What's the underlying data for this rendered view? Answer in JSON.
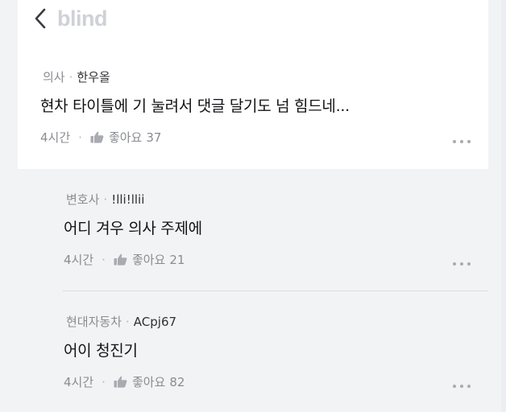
{
  "header": {
    "logo": "blind"
  },
  "post": {
    "company": "의사",
    "nickname": "한우올",
    "text": "현차 타이틀에 기 눌려서 댓글 달기도 넘 힘드네...",
    "time": "4시간",
    "like_label": "좋아요",
    "like_count": "37"
  },
  "comments": [
    {
      "company": "변호사",
      "nickname": "!lli!llii",
      "text": "어디 겨우 의사 주제에",
      "time": "4시간",
      "like_label": "좋아요",
      "like_count": "21"
    },
    {
      "company": "현대자동차",
      "nickname": "ACpj67",
      "text": "어이 청진기",
      "time": "4시간",
      "like_label": "좋아요",
      "like_count": "82"
    }
  ],
  "icons": {
    "back": "chevron-left-icon",
    "like": "thumbs-up-icon",
    "more": "more-horizontal-icon"
  },
  "colors": {
    "background": "#f2f3f5",
    "card": "#ffffff",
    "logo": "#cfd1d6",
    "muted": "#8a8c91"
  }
}
